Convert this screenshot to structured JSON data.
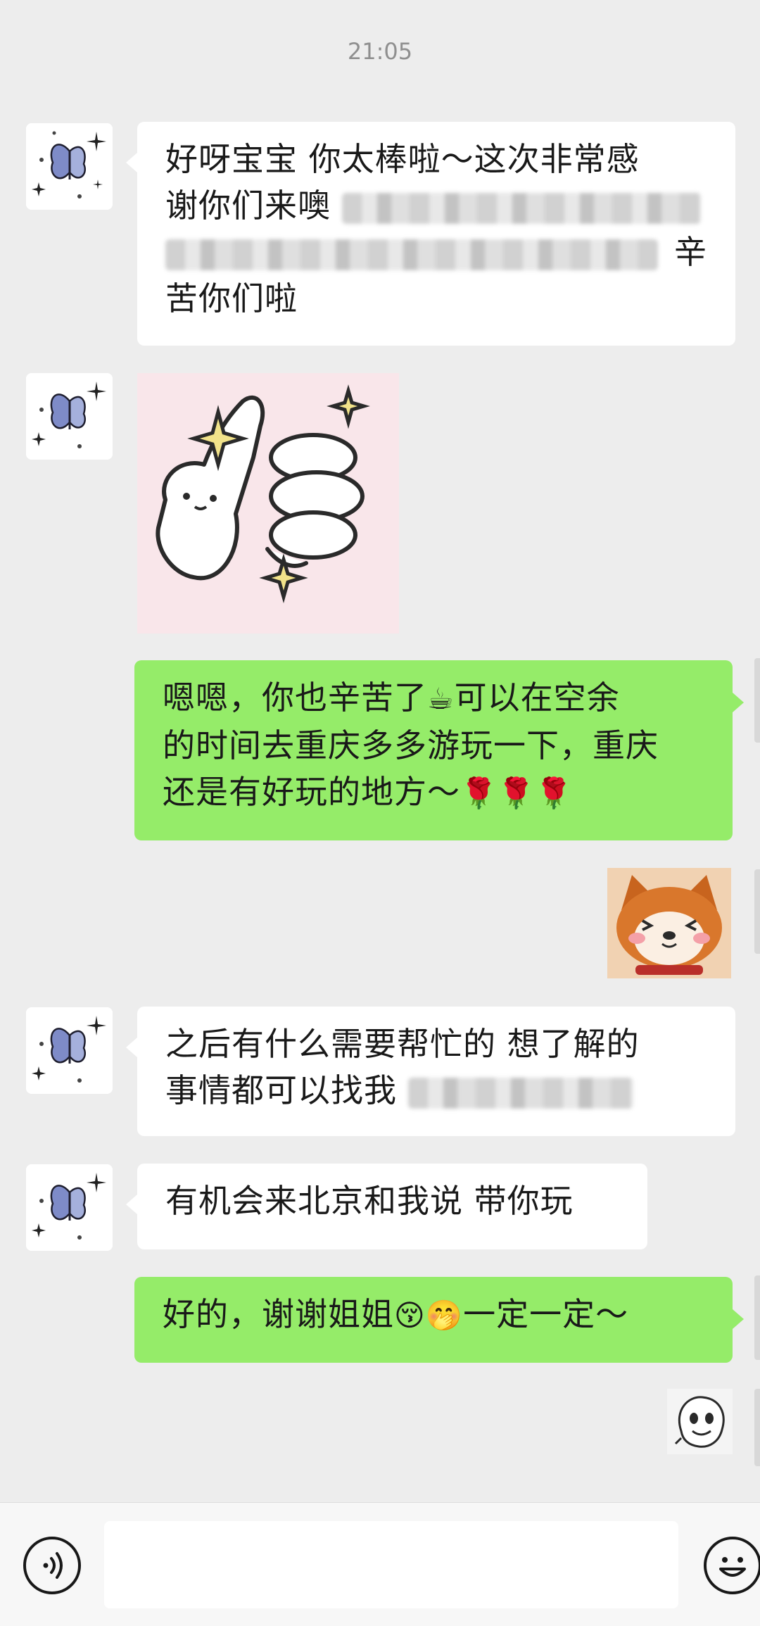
{
  "chat": {
    "timestamp": "21:05",
    "messages": [
      {
        "sender": "contact",
        "line1": "好呀宝宝 你太棒啦～这次非常感",
        "line2": "谢你们来噢",
        "line3_end": "辛",
        "line4": "苦你们啦"
      },
      {
        "sender": "contact",
        "type": "sticker",
        "sticker_icon": "thumbs-up-bear-sticker"
      },
      {
        "sender": "me",
        "line1_a": "嗯嗯，你也辛苦了",
        "line1_emoji": "☕",
        "line1_b": "可以在空余",
        "line2": "的时间去重庆多多游玩一下，重庆",
        "line3": "还是有好玩的地方～",
        "line3_emoji": "🌹🌹🌹"
      },
      {
        "sender": "me",
        "type": "sticker",
        "sticker_icon": "shiba-dog-sticker"
      },
      {
        "sender": "contact",
        "line1": "之后有什么需要帮忙的 想了解的",
        "line2": "事情都可以找我"
      },
      {
        "sender": "contact",
        "line1": "有机会来北京和我说 带你玩"
      },
      {
        "sender": "me",
        "line1_a": "好的，谢谢姐姐",
        "line1_emoji": "😚🤭",
        "line1_b": "一定一定～"
      },
      {
        "sender": "me",
        "type": "sticker",
        "sticker_icon": "cartoon-face-sticker"
      }
    ]
  },
  "contact_avatar_icon": "butterfly-avatar",
  "input_bar": {
    "voice_icon": "voice-icon",
    "input_value": "",
    "emoji_icon": "smiley-icon"
  },
  "colors": {
    "background": "#EDEDED",
    "incoming_bubble": "#FFFFFF",
    "outgoing_bubble": "#95EC69"
  }
}
